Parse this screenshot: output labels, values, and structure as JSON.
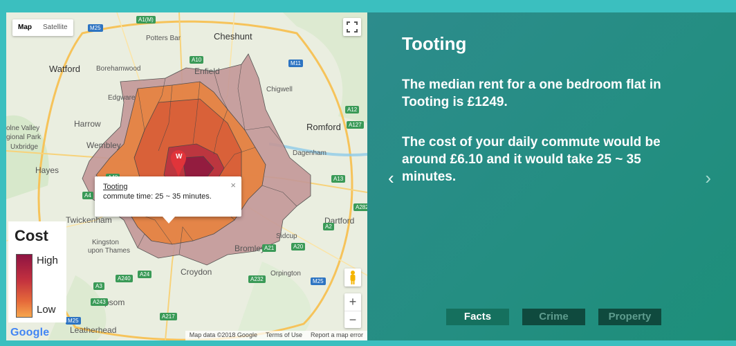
{
  "map": {
    "type_buttons": [
      {
        "label": "Map",
        "active": true
      },
      {
        "label": "Satellite",
        "active": false
      }
    ],
    "place_labels": {
      "cheshunt": "Cheshunt",
      "potters_bar": "Potters Bar",
      "watford": "Watford",
      "borehamwood": "Borehamwood",
      "enfield": "Enfield",
      "edgware": "Edgware",
      "chigwell": "Chigwell",
      "harrow": "Harrow",
      "romford": "Romford",
      "colne_valley": "olne Valley",
      "regional_park": "gional Park",
      "uxbridge": "Uxbridge",
      "wembley": "Wembley",
      "dagenham": "Dagenham",
      "hayes": "Hayes",
      "dartford": "Dartford",
      "twickenham": "Twickenham",
      "sidcup": "Sidcup",
      "kingston": "Kingston",
      "upon_thames": "upon Thames",
      "bromley": "Bromley",
      "croydon": "Croydon",
      "orpington": "Orpington",
      "epsom": "Epsom",
      "leatherhead": "Leatherhead"
    },
    "road_labels": {
      "a1m": "A1(M)",
      "m25_top": "M25",
      "a10": "A10",
      "m11": "M11",
      "a12": "A12",
      "a127": "A127",
      "a13": "A13",
      "a4": "A4",
      "a40": "A40",
      "a282": "A282",
      "a2": "A2",
      "a20": "A20",
      "a21": "A21",
      "a24": "A24",
      "a240": "A240",
      "a232": "A232",
      "a3": "A3",
      "a243": "A243",
      "a217": "A217",
      "m25_bottom": "M25",
      "m25_left": "M25",
      "m25_br": "M25"
    },
    "marker_letter": "W",
    "info_window": {
      "title": "Tooting",
      "body": "commute time: 25 ~ 35 minutes.",
      "close": "×"
    },
    "legend": {
      "title": "Cost",
      "high": "High",
      "low": "Low"
    },
    "zoom": {
      "in": "+",
      "out": "−"
    },
    "logo": "Google",
    "attribution": [
      "Map data ©2018 Google",
      "Terms of Use",
      "Report a map error"
    ]
  },
  "panel": {
    "title": "Tooting",
    "paragraph1": "The median rent for a one bedroom flat in Tooting is £1249.",
    "paragraph2": "The cost of your daily commute would be around £6.10 and it would take 25 ~ 35 minutes.",
    "prev": "‹",
    "next": "›",
    "tabs": [
      {
        "label": "Facts",
        "active": true
      },
      {
        "label": "Crime",
        "active": false
      },
      {
        "label": "Property",
        "active": false
      }
    ]
  }
}
